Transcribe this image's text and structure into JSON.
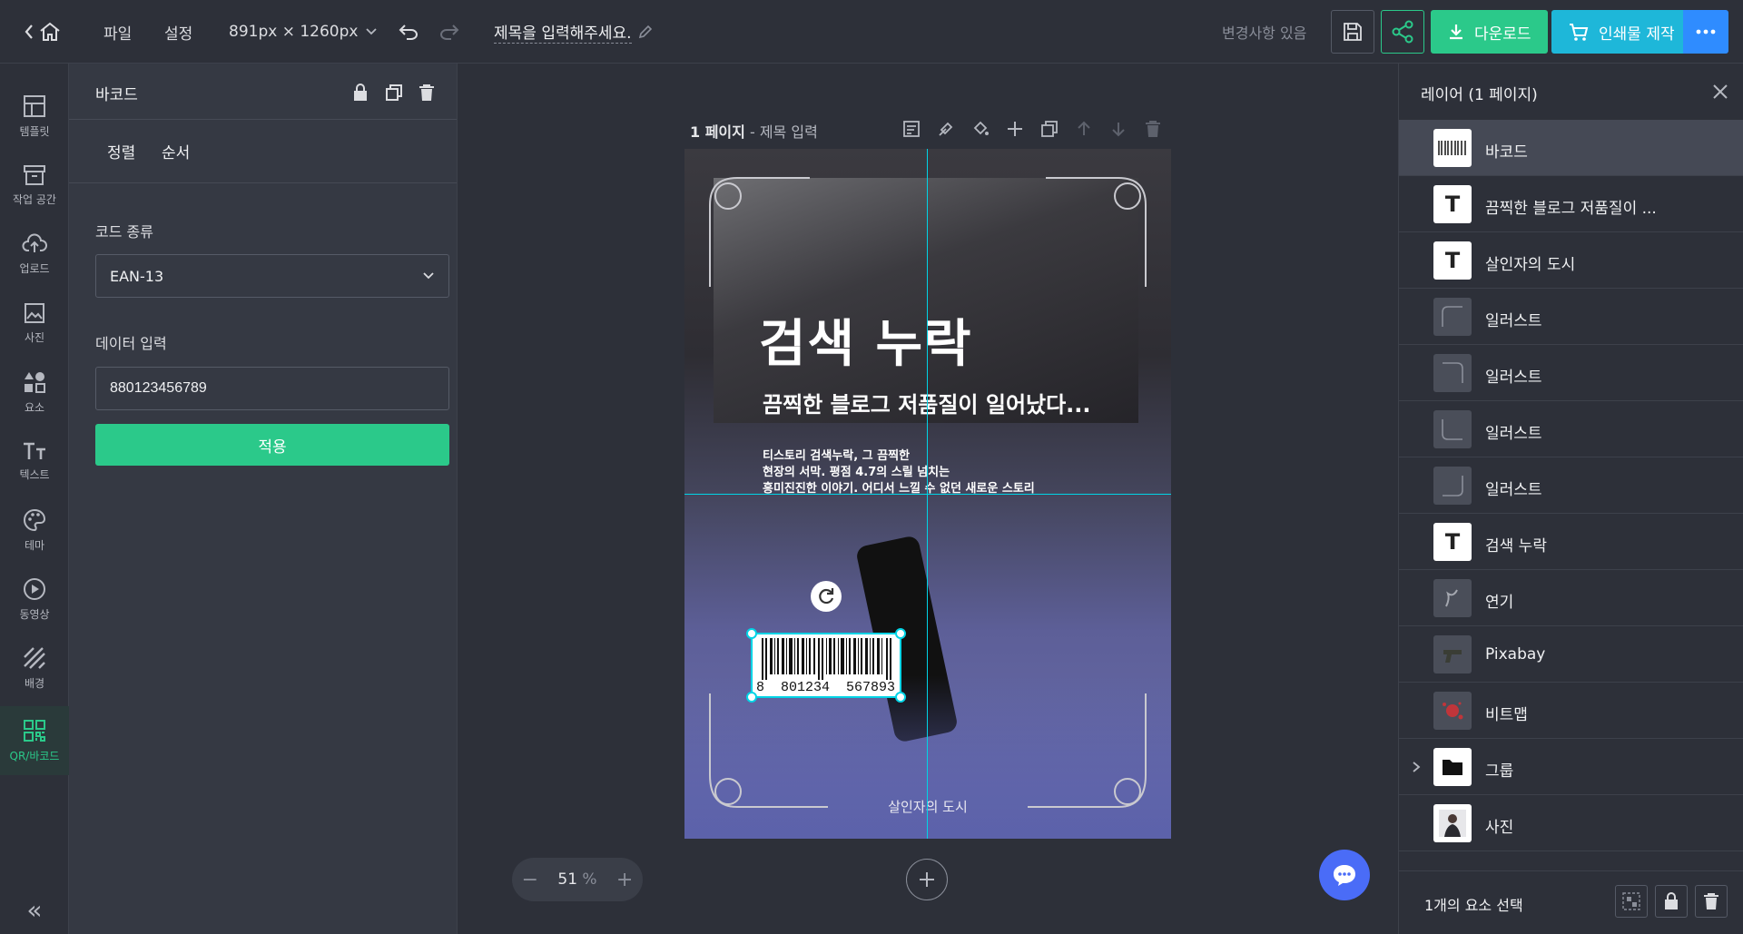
{
  "topbar": {
    "file_menu": "파일",
    "settings_menu": "설정",
    "size_label": "891px × 1260px",
    "title_placeholder": "제목을 입력해주세요.",
    "change_status": "변경사항 있음",
    "download_label": "다운로드",
    "print_label": "인쇄물 제작"
  },
  "leftbar": {
    "items": [
      {
        "label": "템플릿",
        "icon": "template-icon"
      },
      {
        "label": "작업 공간",
        "icon": "workspace-icon"
      },
      {
        "label": "업로드",
        "icon": "upload-icon"
      },
      {
        "label": "사진",
        "icon": "photo-icon"
      },
      {
        "label": "요소",
        "icon": "elements-icon"
      },
      {
        "label": "텍스트",
        "icon": "text-icon"
      },
      {
        "label": "테마",
        "icon": "theme-icon"
      },
      {
        "label": "동영상",
        "icon": "video-icon"
      },
      {
        "label": "배경",
        "icon": "background-icon"
      },
      {
        "label": "QR/바코드",
        "icon": "qr-barcode-icon"
      }
    ],
    "collapse_glyph": "«"
  },
  "props": {
    "title": "바코드",
    "tabs": [
      "정렬",
      "순서"
    ],
    "code_type_label": "코드 종류",
    "code_type_value": "EAN-13",
    "data_label": "데이터 입력",
    "data_value": "880123456789",
    "apply_label": "적용"
  },
  "canvas": {
    "page_number": "1 페이지",
    "page_title": " - 제목 입력",
    "zoom_value": "51",
    "zoom_unit": "%",
    "poster": {
      "title": "검색 누락",
      "subtitle": "끔찍한 블로그 저품질이 일어났다...",
      "desc_line1": "티스토리 검색누락, 그 끔찍한",
      "desc_line2": "현장의 서막. 평점 4.7의 스릴 넘치는",
      "desc_line3": "흥미진진한 이야기. 어디서 느낄 수 없던 새로운 스토리",
      "footer": "살인자의 도시",
      "barcode_digits": "8  801234  567893"
    }
  },
  "layers": {
    "title": "레이어 (1 페이지)",
    "items": [
      {
        "name": "바코드",
        "thumb": "barcode"
      },
      {
        "name": "끔찍한 블로그 저품질이 ...",
        "thumb": "T"
      },
      {
        "name": "살인자의 도시",
        "thumb": "T"
      },
      {
        "name": "일러스트",
        "thumb": "illust"
      },
      {
        "name": "일러스트",
        "thumb": "illust"
      },
      {
        "name": "일러스트",
        "thumb": "illust"
      },
      {
        "name": "일러스트",
        "thumb": "illust"
      },
      {
        "name": "검색 누락",
        "thumb": "T"
      },
      {
        "name": "연기",
        "thumb": "smoke"
      },
      {
        "name": "Pixabay",
        "thumb": "gun"
      },
      {
        "name": "비트맵",
        "thumb": "splat"
      },
      {
        "name": "그룹",
        "thumb": "folder"
      },
      {
        "name": "사진",
        "thumb": "photo"
      }
    ],
    "selection_status": "1개의 요소 선택"
  },
  "colors": {
    "accent_green": "#2bc98a",
    "accent_cyan": "#1eb7d9",
    "accent_blue": "#2f8cff",
    "selection": "#00d4e6"
  }
}
